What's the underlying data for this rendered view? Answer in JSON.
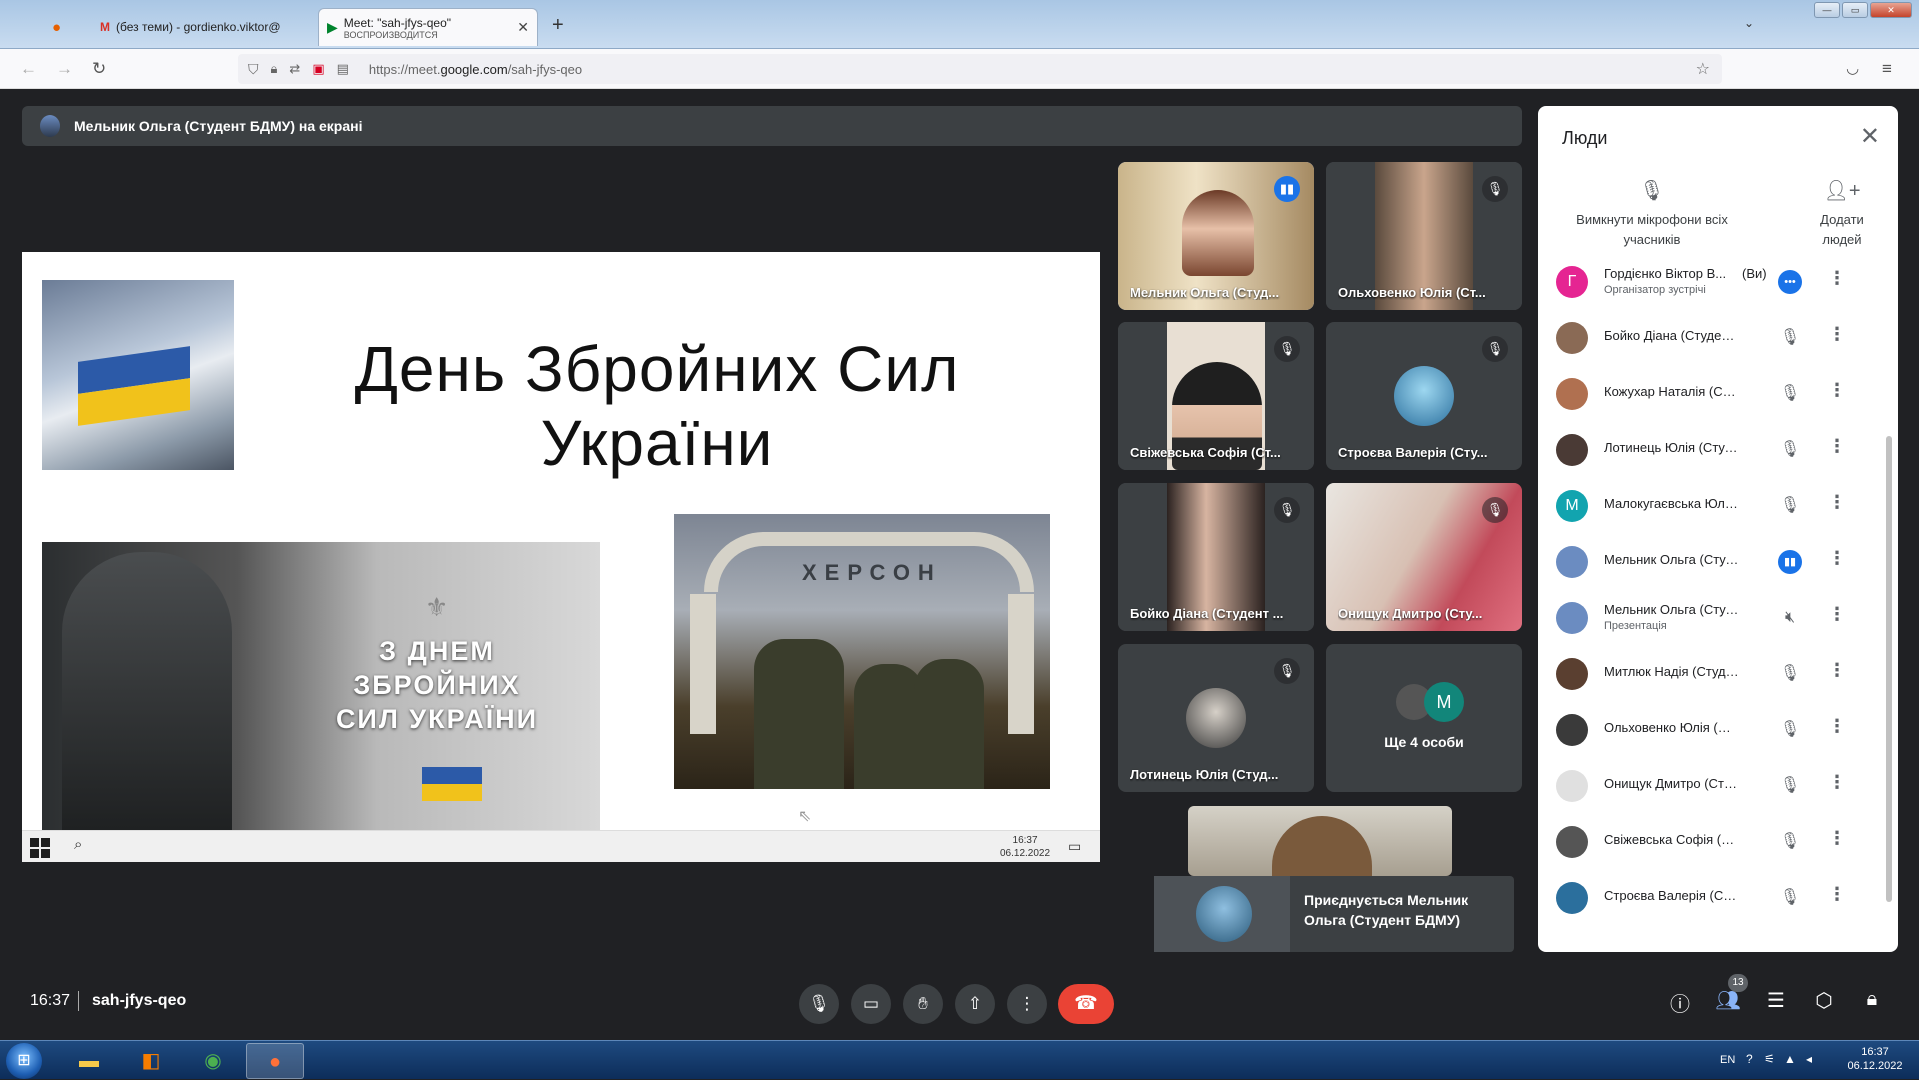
{
  "browser": {
    "tabs": [
      {
        "title": "(без теми) - gordienko.viktor@",
        "active": false
      },
      {
        "title": "Meet: \"sah-jfys-qeo\"",
        "subtitle": "ВОСПРОИЗВОДИТСЯ",
        "active": true
      }
    ],
    "url_prefix": "https://meet.",
    "url_domain": "google.com",
    "url_path": "/sah-jfys-qeo"
  },
  "meet": {
    "presenting_banner": "Мельник Ольга (Студент БДМУ) на екрані",
    "slide": {
      "title_line1": "День Збройних Сил",
      "title_line2": "України",
      "image_caption_line1": "З ДНЕМ",
      "image_caption_line2": "ЗБРОЙНИХ",
      "image_caption_line3": "СИЛ УКРАЇНИ",
      "sign_text": "ХЕРСОН",
      "clock_time": "16:37",
      "clock_date": "06.12.2022"
    },
    "tiles": [
      {
        "name": "Мельник Ольга (Студ...",
        "speaking": true
      },
      {
        "name": "Ольховенко Юлія (Ст...",
        "muted": true
      },
      {
        "name": "Свіжевська Софія (Ст...",
        "muted": true
      },
      {
        "name": "Строєва Валерія (Сту...",
        "muted": true
      },
      {
        "name": "Бойко Діана (Студент ...",
        "muted": true
      },
      {
        "name": "Онищук Дмитро (Сту...",
        "muted": true
      },
      {
        "name": "Лотинець Юлія (Студ...",
        "muted": true
      }
    ],
    "more_tile": {
      "initial": "M",
      "label": "Ще 4 особи"
    },
    "join_toast": "Приєднується Мельник Ольга (Студент БДМУ)",
    "time": "16:37",
    "meeting_code": "sah-jfys-qeo",
    "participant_count": "13",
    "accent_color": "#1a73e8",
    "end_call_color": "#ea4335"
  },
  "people": {
    "title": "Люди",
    "mute_all_label": "Вимкнути мікрофони всіх учасників",
    "add_people_label": "Додати людей",
    "list": [
      {
        "name": "Гордієнко Віктор В...",
        "you": "(Ви)",
        "sub": "Організатор зустрічі",
        "initial": "Г",
        "mic": "on"
      },
      {
        "name": "Бойко Діана (Студент ...",
        "mic": "off"
      },
      {
        "name": "Кожухар Наталія (Студ...",
        "mic": "off"
      },
      {
        "name": "Лотинець Юлія (Студе...",
        "mic": "off"
      },
      {
        "name": "Малокугаєвська Юлія (...",
        "initial": "М",
        "mic": "off"
      },
      {
        "name": "Мельник Ольга (Студе...",
        "mic": "on"
      },
      {
        "name": "Мельник Ольга (Студе...",
        "sub": "Презентація",
        "mic": "present"
      },
      {
        "name": "Митлюк Надія (Студен...",
        "mic": "off"
      },
      {
        "name": "Ольховенко Юлія (Сту...",
        "mic": "off"
      },
      {
        "name": "Онищук Дмитро (Студ...",
        "mic": "off"
      },
      {
        "name": "Свіжевська Софія (Сту...",
        "mic": "off"
      },
      {
        "name": "Строєва Валерія (Студ...",
        "mic": "off"
      }
    ]
  },
  "os": {
    "lang": "EN",
    "time": "16:37",
    "date": "06.12.2022"
  }
}
